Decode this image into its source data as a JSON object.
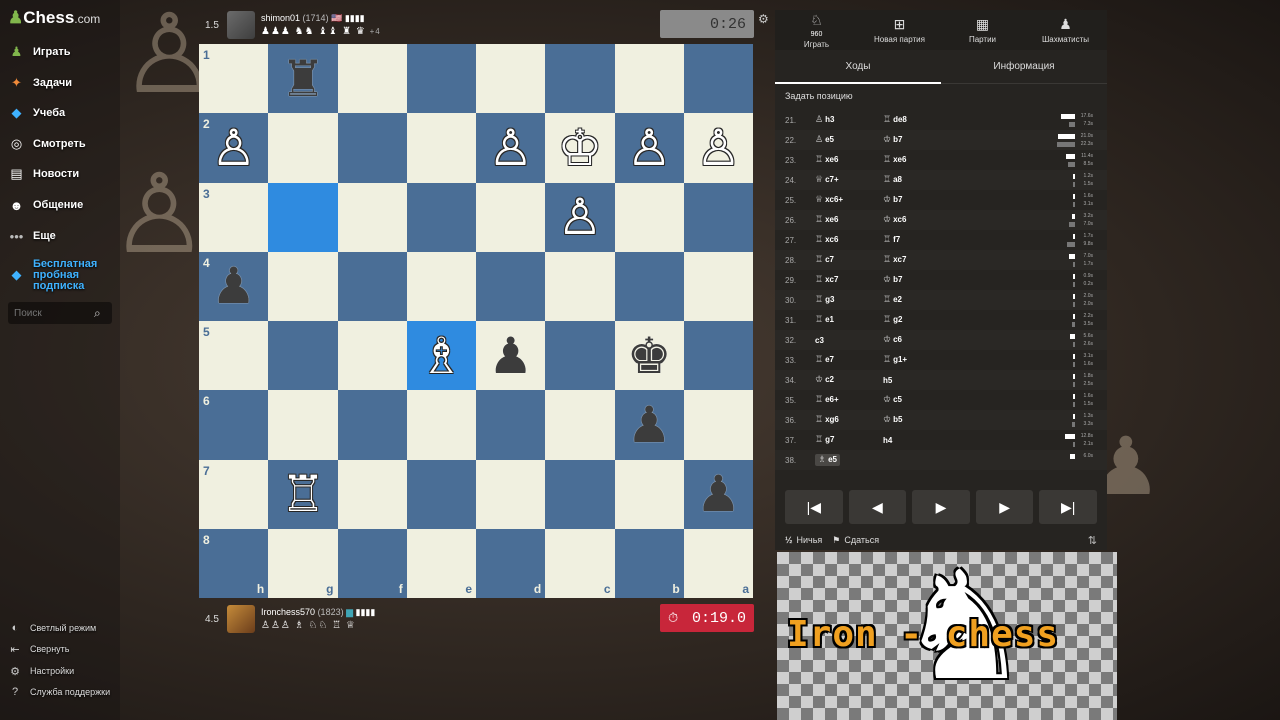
{
  "brand": {
    "logo_pawn": "♟",
    "logo_text": "Chess",
    "logo_suffix": ".com"
  },
  "sidebar": {
    "items": [
      {
        "label": "Играть",
        "icon": "♟",
        "color": "#81b64c"
      },
      {
        "label": "Задачи",
        "icon": "✦",
        "color": "#f08a3a"
      },
      {
        "label": "Учеба",
        "icon": "◆",
        "color": "#3fb2ff"
      },
      {
        "label": "Смотреть",
        "icon": "◎",
        "color": "#ffffff"
      },
      {
        "label": "Новости",
        "icon": "▤",
        "color": "#ffffff"
      },
      {
        "label": "Общение",
        "icon": "☻",
        "color": "#ffffff"
      },
      {
        "label": "Еще",
        "icon": "•••",
        "color": "#bbbbbb"
      }
    ],
    "promo": {
      "label": "Бесплатная пробная подписка",
      "icon": "◆",
      "color": "#3fb2ff"
    },
    "search_placeholder": "Поиск",
    "search_icon": "⌕",
    "bottom": [
      {
        "label": "Светлый режим",
        "icon": "◐"
      },
      {
        "label": "Свернуть",
        "icon": "⇤"
      },
      {
        "label": "Настройки",
        "icon": "⚙"
      },
      {
        "label": "Служба поддержки",
        "icon": "?"
      }
    ]
  },
  "top_player": {
    "score": "1.5",
    "name": "shimon01",
    "rating": "(1714)",
    "flag": "🇺🇸",
    "bars": "▮▮▮▮",
    "captured": "♟♟♟ ♞♞ ♝♝ ♜ ♛",
    "advantage": "+4",
    "clock": "0:26"
  },
  "bottom_player": {
    "score": "4.5",
    "name": "Ironchess570",
    "rating": "(1823)",
    "flag": "▆",
    "bars": "▮▮▮▮",
    "captured": "♙♙♙ ♗ ♘♘ ♖ ♕",
    "clock": "0:19.0",
    "clock_icon": "⏱"
  },
  "board": {
    "ranks": [
      "1",
      "2",
      "3",
      "4",
      "5",
      "6",
      "7",
      "8"
    ],
    "files": [
      "h",
      "g",
      "f",
      "e",
      "d",
      "c",
      "b",
      "a"
    ],
    "highlight": [
      [
        2,
        1
      ],
      [
        4,
        3
      ]
    ],
    "pieces": [
      {
        "r": 0,
        "c": 1,
        "p": "♜",
        "side": "b"
      },
      {
        "r": 1,
        "c": 0,
        "p": "♙",
        "side": "w"
      },
      {
        "r": 1,
        "c": 4,
        "p": "♙",
        "side": "w"
      },
      {
        "r": 1,
        "c": 5,
        "p": "♔",
        "side": "w"
      },
      {
        "r": 1,
        "c": 6,
        "p": "♙",
        "side": "w"
      },
      {
        "r": 1,
        "c": 7,
        "p": "♙",
        "side": "w"
      },
      {
        "r": 2,
        "c": 5,
        "p": "♙",
        "side": "w"
      },
      {
        "r": 3,
        "c": 0,
        "p": "♟",
        "side": "b"
      },
      {
        "r": 4,
        "c": 3,
        "p": "♗",
        "side": "w"
      },
      {
        "r": 4,
        "c": 4,
        "p": "♟",
        "side": "b"
      },
      {
        "r": 4,
        "c": 6,
        "p": "♚",
        "side": "b"
      },
      {
        "r": 5,
        "c": 6,
        "p": "♟",
        "side": "b"
      },
      {
        "r": 6,
        "c": 1,
        "p": "♖",
        "side": "w"
      },
      {
        "r": 6,
        "c": 7,
        "p": "♟",
        "side": "b"
      }
    ]
  },
  "panel": {
    "tabs": [
      {
        "label": "Играть",
        "icon": "♘",
        "badge": "960"
      },
      {
        "label": "Новая партия",
        "icon": "⊞",
        "badge": ""
      },
      {
        "label": "Партии",
        "icon": "▦",
        "badge": ""
      },
      {
        "label": "Шахматисты",
        "icon": "♟",
        "badge": ""
      }
    ],
    "subtabs": [
      "Ходы",
      "Информация"
    ],
    "set_position": "Задать позицию",
    "moves": [
      {
        "n": "21.",
        "w": "h3",
        "wp": "♙",
        "b": "de8",
        "bp": "♖",
        "wt": 17.6,
        "bt": 7.3
      },
      {
        "n": "22.",
        "w": "e5",
        "wp": "♙",
        "b": "b7",
        "bp": "♔",
        "wt": 21.0,
        "bt": 22.3
      },
      {
        "n": "23.",
        "w": "xe6",
        "wp": "♖",
        "b": "xe6",
        "bp": "♖",
        "wt": 11.4,
        "bt": 8.5
      },
      {
        "n": "24.",
        "w": "c7+",
        "wp": "♕",
        "b": "a8",
        "bp": "♖",
        "wt": 1.2,
        "bt": 1.5
      },
      {
        "n": "25.",
        "w": "xc6+",
        "wp": "♕",
        "b": "b7",
        "bp": "♔",
        "wt": 1.6,
        "bt": 3.1
      },
      {
        "n": "26.",
        "w": "xe6",
        "wp": "♖",
        "b": "xc6",
        "bp": "♔",
        "wt": 3.2,
        "bt": 7.0
      },
      {
        "n": "27.",
        "w": "xc6",
        "wp": "♖",
        "b": "f7",
        "bp": "♖",
        "wt": 1.7,
        "bt": 9.8
      },
      {
        "n": "28.",
        "w": "c7",
        "wp": "♖",
        "b": "xc7",
        "bp": "♖",
        "wt": 7.0,
        "bt": 1.7
      },
      {
        "n": "29.",
        "w": "xc7",
        "wp": "♖",
        "b": "b7",
        "bp": "♔",
        "wt": 0.9,
        "bt": 0.2
      },
      {
        "n": "30.",
        "w": "g3",
        "wp": "♖",
        "b": "e2",
        "bp": "♖",
        "wt": 2.0,
        "bt": 2.0
      },
      {
        "n": "31.",
        "w": "e1",
        "wp": "♖",
        "b": "g2",
        "bp": "♖",
        "wt": 2.2,
        "bt": 3.5
      },
      {
        "n": "32.",
        "w": "c3",
        "wp": "",
        "b": "c6",
        "bp": "♔",
        "wt": 5.6,
        "bt": 2.6
      },
      {
        "n": "33.",
        "w": "e7",
        "wp": "♖",
        "b": "g1+",
        "bp": "♖",
        "wt": 3.1,
        "bt": 1.6
      },
      {
        "n": "34.",
        "w": "c2",
        "wp": "♔",
        "b": "h5",
        "bp": "",
        "wt": 1.8,
        "bt": 2.5
      },
      {
        "n": "35.",
        "w": "e6+",
        "wp": "♖",
        "b": "c5",
        "bp": "♔",
        "wt": 1.6,
        "bt": 1.5
      },
      {
        "n": "36.",
        "w": "xg6",
        "wp": "♖",
        "b": "b5",
        "bp": "♔",
        "wt": 1.3,
        "bt": 3.3
      },
      {
        "n": "37.",
        "w": "g7",
        "wp": "♖",
        "b": "h4",
        "bp": "",
        "wt": 12.8,
        "bt": 2.1
      },
      {
        "n": "38.",
        "w": "e5",
        "wp": "♗",
        "b": "",
        "bp": "",
        "wt": 6.0,
        "bt": null
      }
    ],
    "controls": [
      {
        "name": "first-move-button",
        "icon": "|◀"
      },
      {
        "name": "prev-move-button",
        "icon": "◀"
      },
      {
        "name": "play-button",
        "icon": "▶"
      },
      {
        "name": "next-move-button",
        "icon": "▶"
      },
      {
        "name": "last-move-button",
        "icon": "▶|"
      }
    ],
    "draw_label": "Ничья",
    "draw_icon": "½",
    "resign_label": "Сдаться",
    "resign_icon": "⚑",
    "flip_icon": "⇅"
  },
  "overlay": {
    "text": "Iron - chess",
    "icon": "♞"
  },
  "colors": {
    "accent": "#81b64c",
    "clock_low": "#c8263a",
    "board_light": "#f0f0e0",
    "board_dark": "#4a6e96",
    "highlight": "#2f8be0"
  }
}
